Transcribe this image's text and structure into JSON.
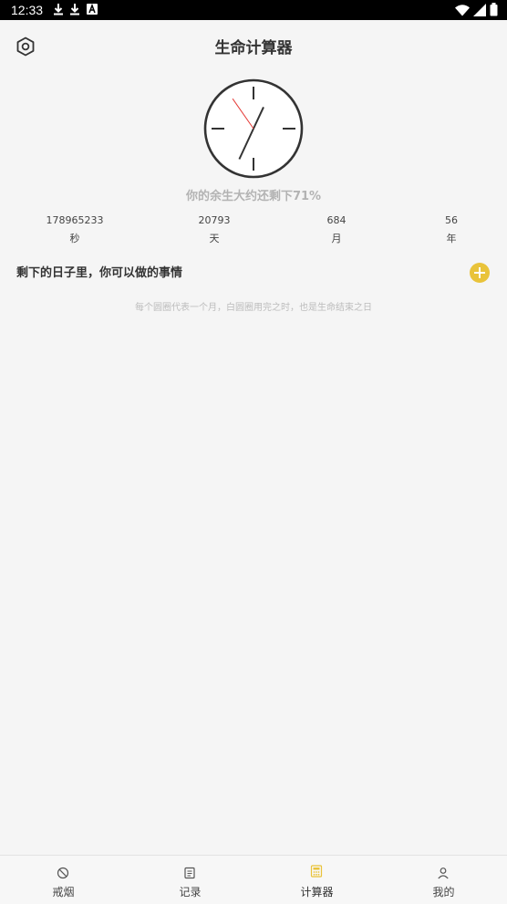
{
  "status_bar": {
    "time": "12:33"
  },
  "header": {
    "title": "生命计算器",
    "settings_icon": "settings-hex-icon"
  },
  "clock": {
    "hour_hand_angle_deg": 25,
    "minute_hand_angle_deg": 205,
    "second_hand_angle_deg": -35
  },
  "summary": {
    "remaining_text": "你的余生大约还剩下71%"
  },
  "stats": [
    {
      "value": "178965233",
      "unit": "秒"
    },
    {
      "value": "20793",
      "unit": "天"
    },
    {
      "value": "684",
      "unit": "月"
    },
    {
      "value": "56",
      "unit": "年"
    }
  ],
  "things": {
    "label": "剩下的日子里，你可以做的事情",
    "hint": "每个圆圈代表一个月，白圆圈用完之时，也是生命结束之日"
  },
  "colors": {
    "accent": "#e9c33a",
    "second_hand": "#e53935"
  },
  "tabbar": {
    "tabs": [
      {
        "label": "戒烟",
        "icon": "no-smoking-icon"
      },
      {
        "label": "记录",
        "icon": "notes-icon"
      },
      {
        "label": "计算器",
        "icon": "calculator-icon",
        "active": true
      },
      {
        "label": "我的",
        "icon": "profile-icon"
      }
    ]
  }
}
